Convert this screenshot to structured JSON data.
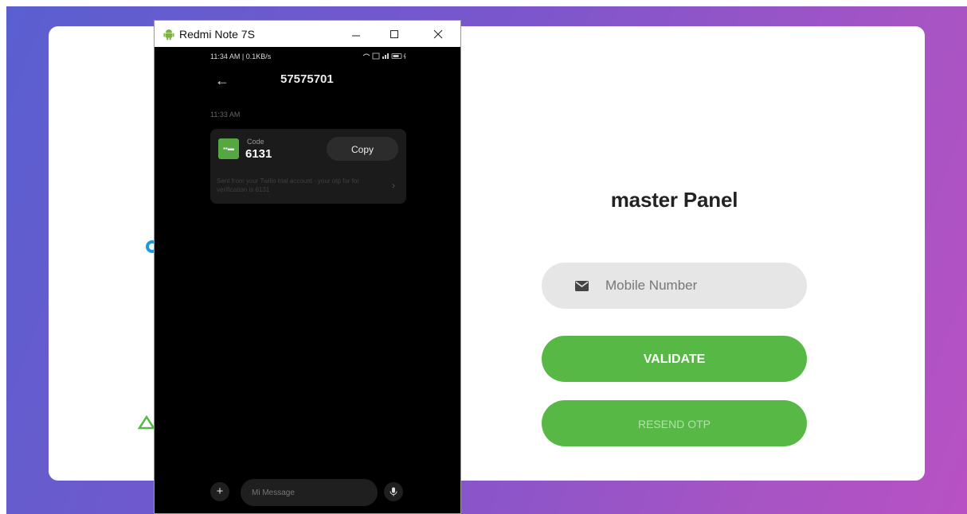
{
  "app": {
    "panel_title": "master Panel",
    "mobile_placeholder": "Mobile Number",
    "validate_label": "VALIDATE",
    "resend_label": "RESEND OTP"
  },
  "emulator": {
    "window_title": "Redmi Note 7S",
    "status_left": "11:34 AM | 0.1KB/s",
    "status_right": "",
    "contact": "57575701",
    "message_time": "11:33 AM",
    "code_label": "Code",
    "code_value": "6131",
    "copy_label": "Copy",
    "message_body": "Sent from your Twilio trial account - your otp for for verification is 6131",
    "message_input_placeholder": "Mi Message"
  },
  "colors": {
    "accent_green": "#57b846",
    "bg_gradient_start": "#5a5fd0",
    "bg_gradient_end": "#b851c4"
  }
}
